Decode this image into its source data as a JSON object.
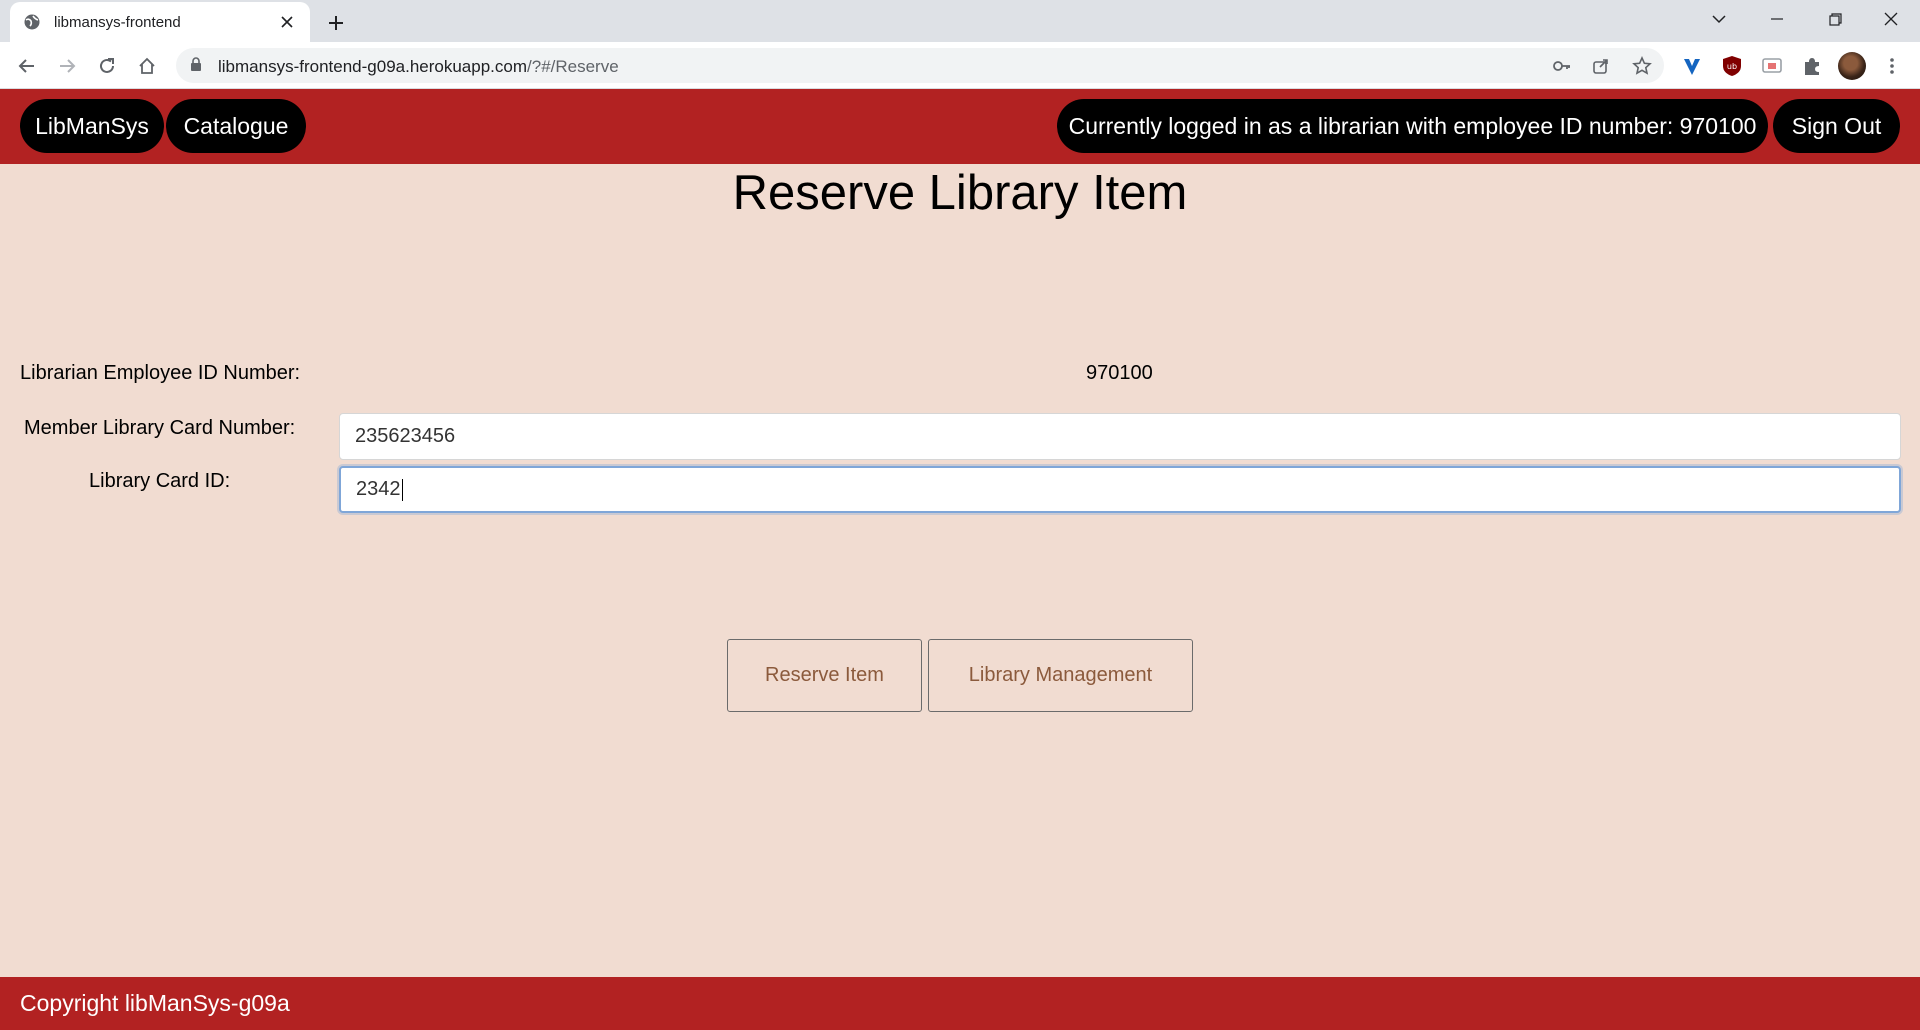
{
  "browser": {
    "tab_title": "libmansys-frontend",
    "url_host": "libmansys-frontend-g09a.herokuapp.com",
    "url_path": "/?#/Reserve"
  },
  "nav": {
    "brand": "LibManSys",
    "catalogue": "Catalogue",
    "login_status": "Currently logged in as a librarian with employee ID number: 970100",
    "sign_out": "Sign Out"
  },
  "page": {
    "title": "Reserve Library Item"
  },
  "form": {
    "employee_id_label": "Librarian Employee ID Number:",
    "employee_id_value": "970100",
    "member_card_label": "Member Library Card Number:",
    "member_card_value": "235623456",
    "card_id_label": "Library Card ID:",
    "card_id_value": "2342"
  },
  "actions": {
    "reserve": "Reserve Item",
    "management": "Library Management"
  },
  "footer": {
    "copyright": "Copyright libManSys-g09a"
  },
  "colors": {
    "brand_red": "#b22222",
    "page_bg": "#f1dcd1",
    "pill_bg": "#000000",
    "button_text": "#8b5a3c"
  }
}
